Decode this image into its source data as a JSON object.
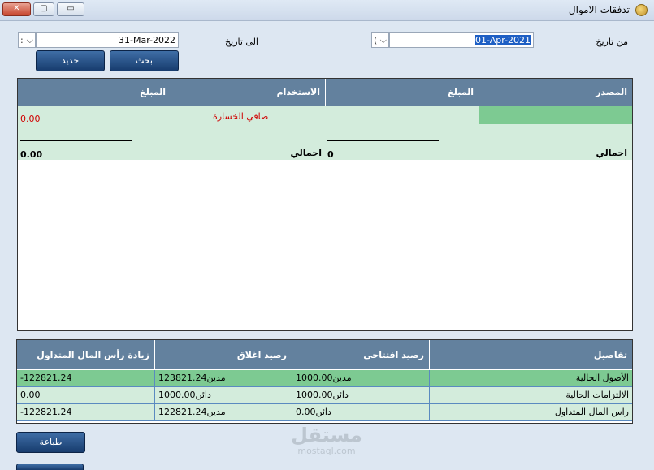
{
  "window": {
    "title": "تدفقات الاموال",
    "close_glyph": "✕",
    "restore_glyph": "▢",
    "minimize_glyph": "▭"
  },
  "filters": {
    "from_label": "من تاريخ",
    "from_value": "01-Apr-2021",
    "from_dropdown_value": "(",
    "to_label": "الى تاريخ",
    "to_value": "31-Mar-2022",
    "to_dropdown_value": ":",
    "dropdown_glyph": "⌵"
  },
  "buttons": {
    "search_label": "بحث",
    "new_label": "جديد",
    "print_label": "طباعة"
  },
  "flow_table": {
    "headers": {
      "source": "المصدر",
      "amount_1": "المبلغ",
      "usage": "الاستخدام",
      "amount_2": "المبلغ"
    },
    "net_loss_label": "صافي الخسارة",
    "net_loss_value": "0.00",
    "source_total_label": "اجمالي",
    "source_total_value": "0",
    "usage_total_label": "اجمالي",
    "usage_total_value": "0.00"
  },
  "details_grid": {
    "headers": [
      "تفاصيل",
      "رصيد افتتاحي",
      "رصيد اغلاق",
      "زيادة رأس المال المتداول"
    ],
    "rows": [
      {
        "detail": "الأصول الحالية",
        "opening": "1000.00مدين",
        "closing": "123821.24مدين",
        "increase": "-122821.24"
      },
      {
        "detail": "الالتزامات الحالية",
        "opening": "1000.00دائن",
        "closing": "1000.00دائن",
        "increase": "0.00"
      },
      {
        "detail": "راس المال المتداول",
        "opening": "0.00دائن",
        "closing": "122821.24مدين",
        "increase": "-122821.24"
      }
    ]
  },
  "watermark": {
    "arabic": "مستقل",
    "latin": "mostaql.com"
  },
  "colors": {
    "header_bg": "#63819e",
    "row_bg": "#d3ecdc",
    "row_selected_bg": "#7dca92",
    "loss_text": "#d00000"
  }
}
